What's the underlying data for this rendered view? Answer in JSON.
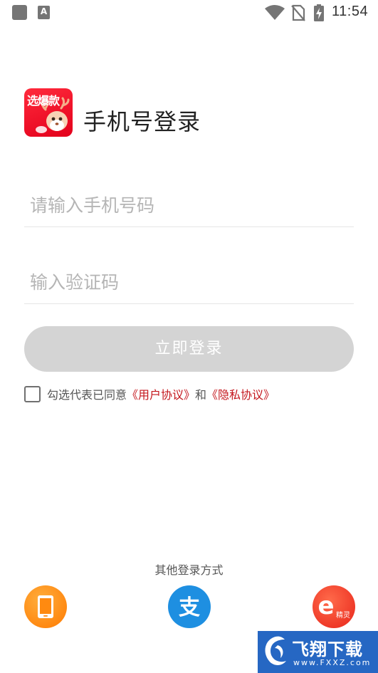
{
  "status_bar": {
    "time": "11:54",
    "notification_letter": "A",
    "icons": [
      "square-notification-icon",
      "a-notification-icon",
      "wifi-icon",
      "no-sim-icon",
      "battery-charging-icon"
    ]
  },
  "header": {
    "logo_text": "选爆款",
    "title": "手机号登录"
  },
  "form": {
    "phone_placeholder": "请输入手机号码",
    "code_placeholder": "输入验证码",
    "login_button": "立即登录"
  },
  "agreement": {
    "prefix": "勾选代表已同意",
    "user_agreement": "《用户协议》",
    "conjunction": "和",
    "privacy_policy": "《隐私协议》",
    "checked": false
  },
  "other_login": {
    "title": "其他登录方式",
    "ejingling_label": "精灵",
    "alipay_glyph": "支",
    "ejingling_letter": "e"
  },
  "watermark": {
    "title": "飞翔下载",
    "url": "www.FXXZ.com"
  },
  "colors": {
    "brand_red": "#e3001b",
    "link_red": "#c4161c",
    "button_disabled": "#d4d4d4",
    "alipay_blue": "#1e8fe1",
    "phone_orange": "#ff7a00"
  }
}
